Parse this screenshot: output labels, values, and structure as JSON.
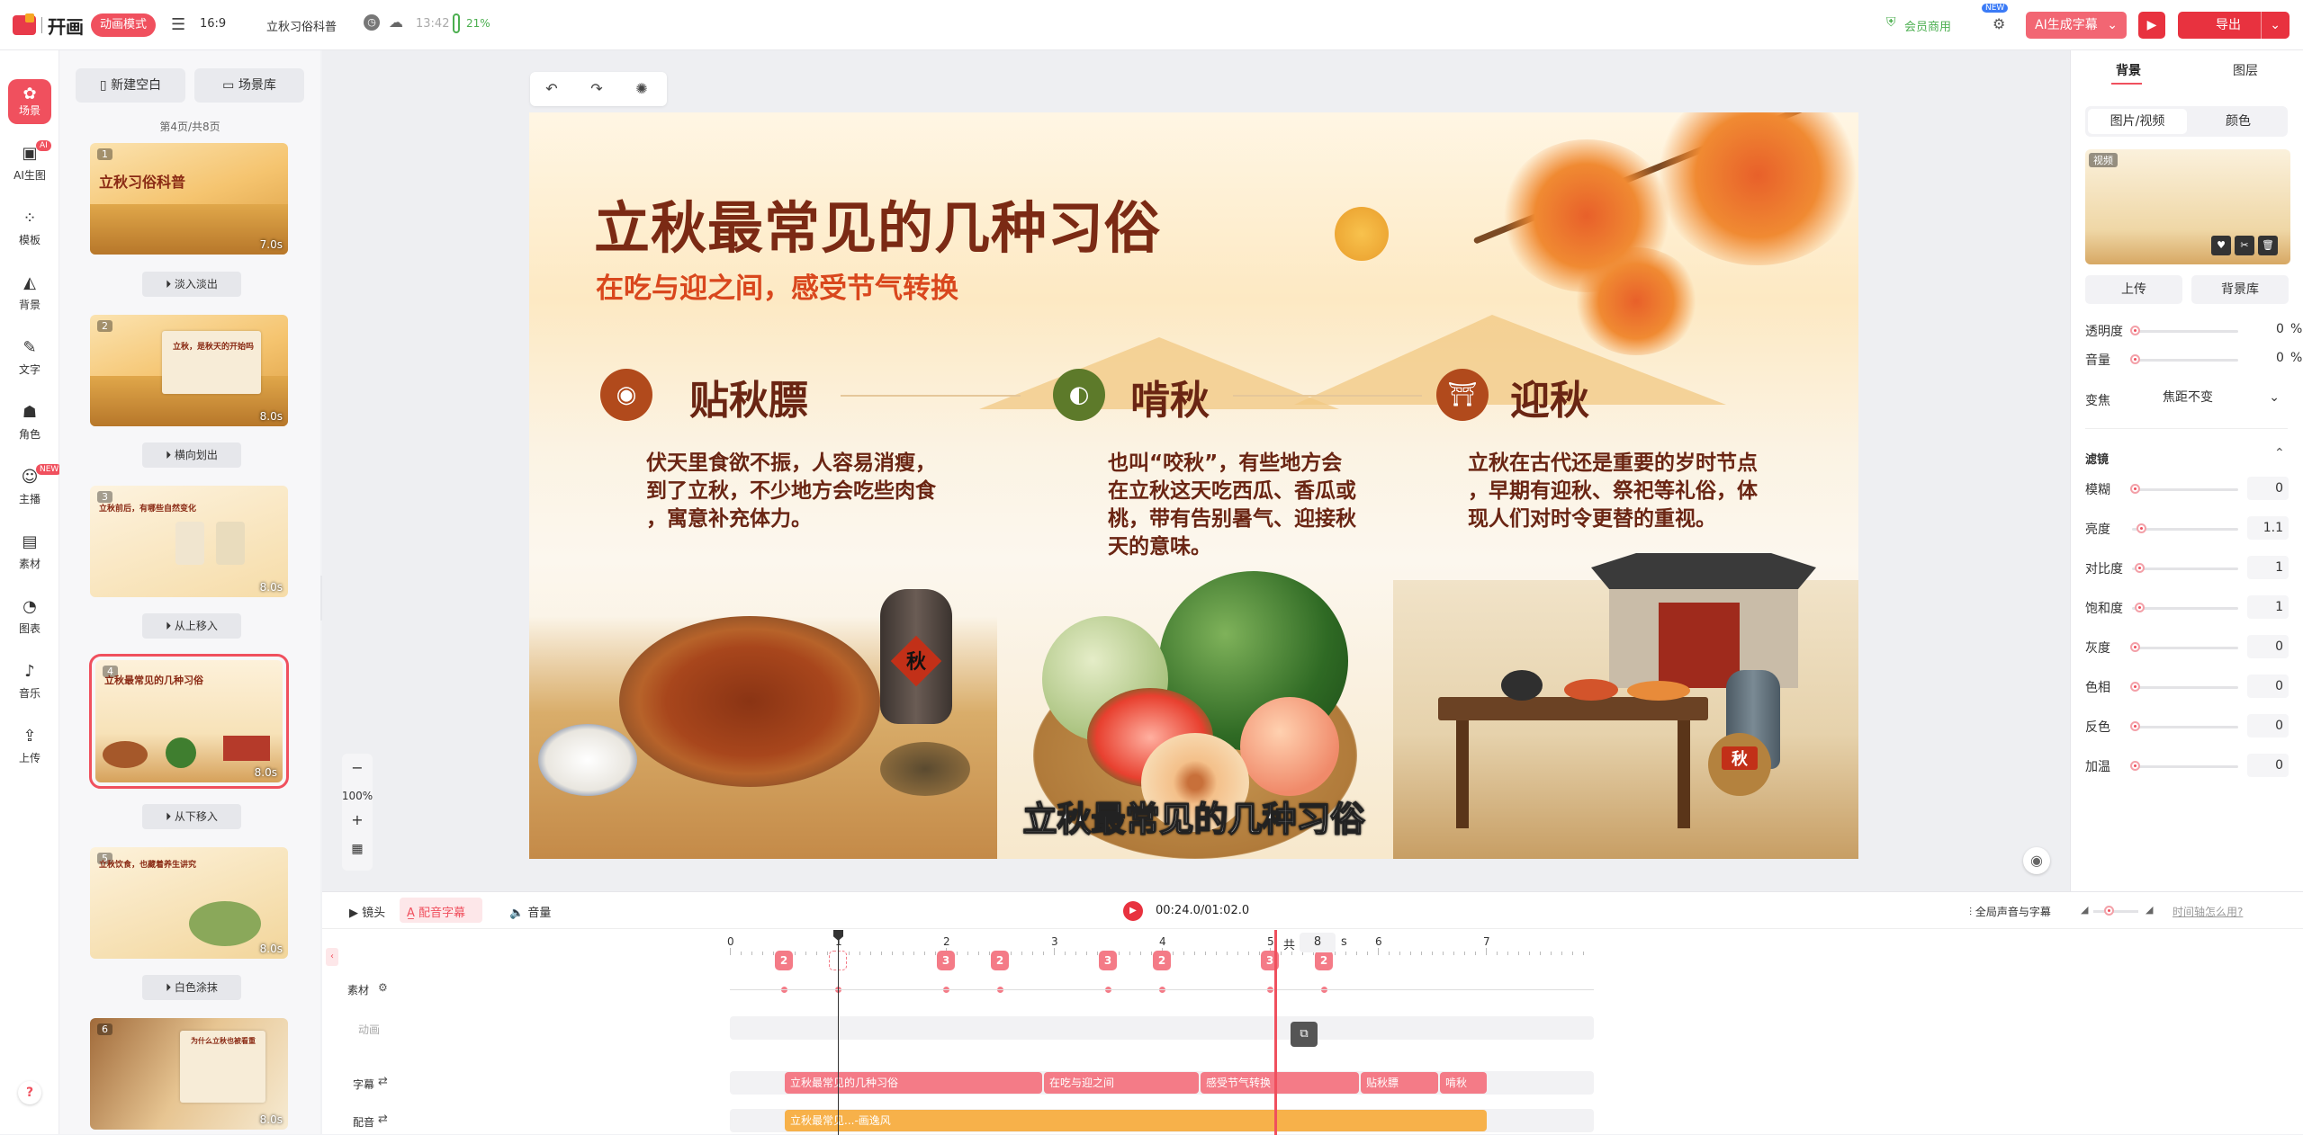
{
  "topbar": {
    "logo_text": "幵画",
    "mode_label": "动画模式",
    "ratio": "16:9",
    "project_name": "立秋习俗科普",
    "time": "13:42",
    "battery": "21%",
    "member_label": "会员商用",
    "new_badge": "NEW",
    "ai_subtitle_label": "AI生成字幕",
    "export_label": "导出"
  },
  "rail": {
    "items": [
      {
        "label": "场景",
        "icon": "scene-icon"
      },
      {
        "label": "AI生图",
        "icon": "ai-image-icon",
        "badge": "AI"
      },
      {
        "label": "模板",
        "icon": "template-icon"
      },
      {
        "label": "背景",
        "icon": "background-icon"
      },
      {
        "label": "文字",
        "icon": "text-icon"
      },
      {
        "label": "角色",
        "icon": "character-icon"
      },
      {
        "label": "主播",
        "icon": "anchor-icon",
        "badge": "NEW"
      },
      {
        "label": "素材",
        "icon": "material-icon"
      },
      {
        "label": "图表",
        "icon": "chart-icon"
      },
      {
        "label": "音乐",
        "icon": "music-icon"
      },
      {
        "label": "上传",
        "icon": "upload-icon"
      }
    ],
    "help": "?"
  },
  "scenes": {
    "new_blank": "新建空白",
    "library": "场景库",
    "page_count": "第4页/共8页",
    "thumbs": [
      {
        "num": "1",
        "title": "立秋习俗科普",
        "duration": "7.0s"
      },
      {
        "num": "2",
        "title": "立秋，是秋天的开始吗",
        "duration": "8.0s"
      },
      {
        "num": "3",
        "title": "立秋前后，有哪些自然变化",
        "duration": "8.0s"
      },
      {
        "num": "4",
        "title": "立秋最常见的几种习俗",
        "duration": "8.0s"
      },
      {
        "num": "5",
        "title": "立秋饮食，也藏着养生讲究",
        "duration": "8.0s"
      },
      {
        "num": "6",
        "title": "为什么立秋也被看重",
        "duration": "8.0s"
      }
    ],
    "transitions": [
      "淡入淡出",
      "横向划出",
      "从上移入",
      "从下移入",
      "白色涂抹"
    ]
  },
  "zoom": {
    "minus": "−",
    "value": "100%",
    "plus": "+"
  },
  "canvas": {
    "title": "立秋最常见的几种习俗",
    "subtitle": "在吃与迎之间，感受节气转换",
    "sections": [
      {
        "icon": "bowl-icon",
        "title": "贴秋膘",
        "body": [
          "伏天里食欲不振，人容易消瘦，",
          "到了立秋，不少地方会吃些肉食",
          "，寓意补充体力。"
        ]
      },
      {
        "icon": "melon-icon",
        "title": "啃秋",
        "body": [
          "也叫“咬秋”，有些地方会",
          "在立秋这天吃西瓜、香瓜或",
          "桃，带有告别暑气、迎接秋",
          "天的意味。"
        ]
      },
      {
        "icon": "gate-icon",
        "title": "迎秋",
        "body": [
          "立秋在古代还是重要的岁时节点",
          "，早期有迎秋、祭祀等礼俗，体",
          "现人们对时令更替的重视。"
        ]
      }
    ],
    "jar_label": "秋",
    "basket_label": "秋",
    "caption": "立秋最常见的几种习俗"
  },
  "right_panel": {
    "tabs": [
      "背景",
      "图层"
    ],
    "seg": [
      "图片/视频",
      "颜色"
    ],
    "video_badge": "视频",
    "upload": "上传",
    "bg_library": "背景库",
    "opacity_label": "透明度",
    "opacity_value": "0",
    "volume_label": "音量",
    "volume_value": "0",
    "percent": "%",
    "zoom_label": "变焦",
    "zoom_value": "焦距不变",
    "filter_label": "滤镜",
    "filters": [
      {
        "label": "模糊",
        "value": "0",
        "level": 0
      },
      {
        "label": "亮度",
        "value": "1.1",
        "level": 0.06
      },
      {
        "label": "对比度",
        "value": "1",
        "level": 0.04
      },
      {
        "label": "饱和度",
        "value": "1",
        "level": 0.04
      },
      {
        "label": "灰度",
        "value": "0",
        "level": 0
      },
      {
        "label": "色相",
        "value": "0",
        "level": 0
      },
      {
        "label": "反色",
        "value": "0",
        "level": 0
      },
      {
        "label": "加温",
        "value": "0",
        "level": 0
      }
    ]
  },
  "timeline": {
    "tab_camera": "镜头",
    "tab_voice_sub": "配音字幕",
    "tab_volume": "音量",
    "time": "00:24.0/01:02.0",
    "global_label": "全局声音与字幕",
    "help_link": "时间轴怎么用?",
    "total_label": "共",
    "total_value": "8",
    "unit": "s",
    "ticks": [
      "0",
      "1",
      "2",
      "3",
      "4",
      "5",
      "6",
      "7"
    ],
    "row_material": "素材",
    "row_anim": "动画",
    "row_subtitle": "字幕",
    "row_voice": "配音",
    "keyframes": [
      "2",
      "3",
      "3",
      "2",
      "3",
      "2",
      "3",
      "2"
    ],
    "subtitle_clips": [
      "立秋最常见的几种习俗",
      "在吃与迎之间",
      "感受节气转换",
      "贴秋膘",
      "啃秋"
    ],
    "voice_clip": "立秋最常见...-画逸风"
  },
  "colors": {
    "accent": "#f0505e",
    "title_brown": "#7b2a14",
    "subtitle_orange": "#d9471d",
    "voice_orange": "#f7b14a"
  }
}
